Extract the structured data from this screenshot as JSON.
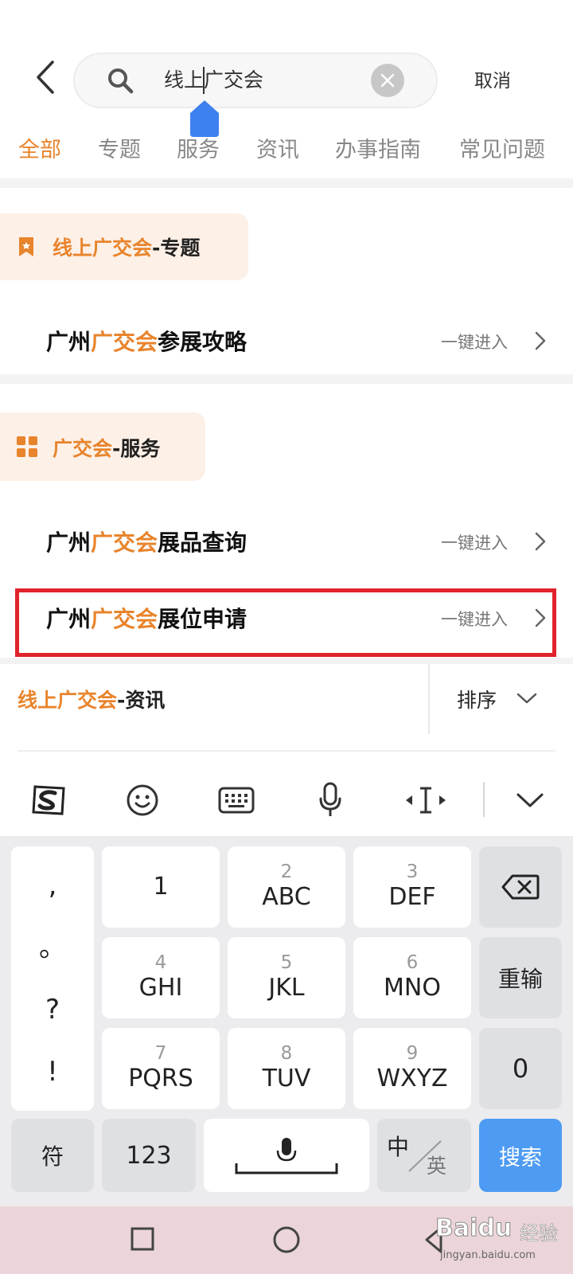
{
  "search": {
    "query": "线上广交会",
    "cancel_label": "取消"
  },
  "tabs": [
    {
      "label": "全部",
      "active": true
    },
    {
      "label": "专题",
      "active": false
    },
    {
      "label": "服务",
      "active": false
    },
    {
      "label": "资讯",
      "active": false
    },
    {
      "label": "办事指南",
      "active": false
    },
    {
      "label": "常见问题",
      "active": false
    }
  ],
  "sections": {
    "topic": {
      "title_highlight": "线上广交会",
      "title_rest": "-专题",
      "icon": "bookmark-icon",
      "items": [
        {
          "prefix": "广州",
          "highlight": "广交会",
          "suffix": "参展攻略",
          "action": "一键进入"
        }
      ]
    },
    "service": {
      "title_highlight": "广交会",
      "title_rest": "-服务",
      "icon": "grid-icon",
      "items": [
        {
          "prefix": "广州",
          "highlight": "广交会",
          "suffix": "展品查询",
          "action": "一键进入"
        },
        {
          "prefix": "广州",
          "highlight": "广交会",
          "suffix": "展位申请",
          "action": "一键进入"
        }
      ]
    },
    "news": {
      "title_highlight": "线上广交会",
      "title_rest": "-资讯",
      "sort_label": "排序"
    }
  },
  "keyboard": {
    "toolbar_icons": [
      "sogou-logo-icon",
      "emoji-icon",
      "keyboard-icon",
      "microphone-icon",
      "cursor-move-icon",
      "collapse-icon"
    ],
    "punct": [
      ",",
      "。",
      "?",
      "!"
    ],
    "keys": [
      {
        "num": "",
        "letters": "1"
      },
      {
        "num": "2",
        "letters": "ABC"
      },
      {
        "num": "3",
        "letters": "DEF"
      },
      {
        "num": "4",
        "letters": "GHI"
      },
      {
        "num": "5",
        "letters": "JKL"
      },
      {
        "num": "6",
        "letters": "MNO"
      },
      {
        "num": "7",
        "letters": "PQRS"
      },
      {
        "num": "8",
        "letters": "TUV"
      },
      {
        "num": "9",
        "letters": "WXYZ"
      }
    ],
    "reinput_label": "重输",
    "zero_label": "0",
    "symbol_label": "符",
    "num_label": "123",
    "lang_zh": "中",
    "lang_en": "英",
    "search_label": "搜索"
  },
  "watermark": {
    "brand": "Bai",
    "paw": "du",
    "sub": "经验",
    "url": "jingyan.baidu.com"
  },
  "colors": {
    "accent": "#e8842c",
    "highlight_box": "#e0232b",
    "search_key": "#4e9bf3"
  }
}
